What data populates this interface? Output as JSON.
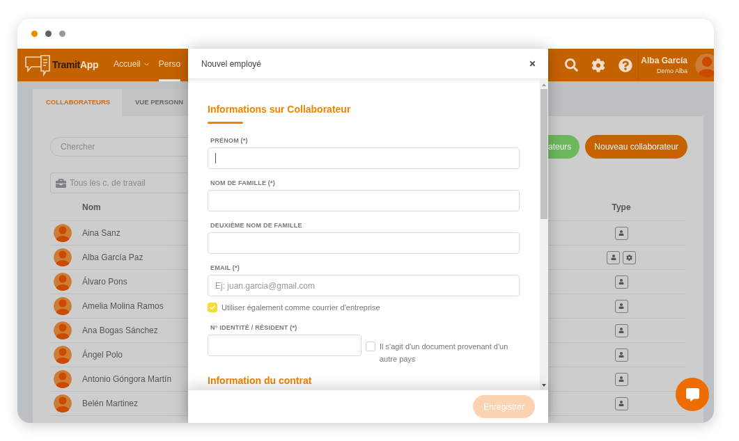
{
  "browser": {
    "dots": [
      {
        "color": "#f08a00"
      },
      {
        "color": "#5f5f5f"
      },
      {
        "color": "#9a9a9a"
      }
    ]
  },
  "header": {
    "logo": {
      "text": "Tramit",
      "accent": "App"
    },
    "nav": [
      {
        "label": "Accueil",
        "dropdown": true,
        "selected": false
      },
      {
        "label": "Perso",
        "dropdown": false,
        "selected": true
      }
    ],
    "user": {
      "name": "Alba García",
      "company": "Demo Alba"
    }
  },
  "tabs": [
    {
      "label": "COLLABORATEURS",
      "selected": true
    },
    {
      "label": "VUE PERSONN",
      "selected": false
    }
  ],
  "search": {
    "placeholder": "Chercher"
  },
  "workplace_filter": {
    "placeholder": "Tous les c. de travail"
  },
  "actions": [
    {
      "label": "ateurs",
      "kind": "secondary"
    },
    {
      "label": "Nouveau collaborateur",
      "kind": "primary"
    }
  ],
  "table": {
    "columns": [
      "Nom",
      "Type"
    ],
    "rows": [
      {
        "name": "Aina Sanz",
        "types": [
          {
            "kind": "user"
          }
        ]
      },
      {
        "name": "Alba García Paz",
        "types": [
          {
            "kind": "user"
          },
          {
            "kind": "admin"
          }
        ]
      },
      {
        "name": "Álvaro Pons",
        "types": [
          {
            "kind": "user"
          }
        ]
      },
      {
        "name": "Amelia Molina Ramos",
        "types": [
          {
            "kind": "user"
          }
        ]
      },
      {
        "name": "Ana Bogas Sánchez",
        "types": [
          {
            "kind": "user"
          }
        ]
      },
      {
        "name": "Ángel Polo",
        "types": [
          {
            "kind": "user"
          }
        ]
      },
      {
        "name": "Antonio Góngora Martín",
        "types": [
          {
            "kind": "user"
          }
        ]
      },
      {
        "name": "Belén Martinez",
        "types": [
          {
            "kind": "user"
          }
        ]
      }
    ]
  },
  "modal": {
    "title": "Nouvel employé",
    "section_title": "Informations sur Collaborateur",
    "fields": [
      {
        "label": "PRÉNOM (*)",
        "kind": "full",
        "focused": true
      },
      {
        "label": "NOM DE FAMILLE (*)",
        "kind": "full",
        "focused": false
      },
      {
        "label": "DEUXIÈME NOM DE FAMILLE",
        "kind": "full",
        "focused": false
      },
      {
        "label": "EMAIL (*)",
        "kind": "full",
        "focused": false,
        "placeholder": "Ej: juan.garcia@gmail.com",
        "checkbox": {
          "label": "Utiliser également comme courrier d'entreprise",
          "checked": true
        }
      },
      {
        "label": "N° IDENTITÉ / RÉSIDENT (*)",
        "kind": "half",
        "focused": false,
        "checkbox": {
          "label": "Il s'agit d'un document provenant d'un autre pays",
          "checked": false
        }
      }
    ],
    "next_section_title": "Information du contrat",
    "save_button": {
      "label": "Enregistrer",
      "disabled": true
    }
  }
}
